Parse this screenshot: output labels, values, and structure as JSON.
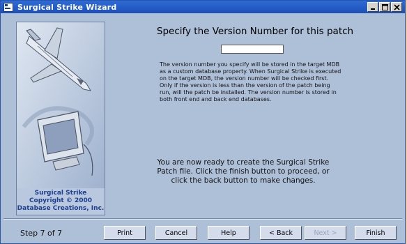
{
  "window": {
    "title": "Surgical Strike Wizard",
    "controls": [
      "minimize",
      "maximize",
      "close"
    ]
  },
  "left_panel": {
    "credit_lines": [
      "Surgical Strike",
      "Copyright © 2000",
      "Database Creations, Inc."
    ]
  },
  "main": {
    "heading": "Specify the Version Number for this patch",
    "version_input": {
      "value": "",
      "placeholder": ""
    },
    "description": "The version number you specify will be stored in the target MDB as a custom database property. When Surgical Strike is executed on the target MDB, the version number will be checked first. Only if the version is less than the version of the patch being run, will the patch be installed. The version number is stored in both front end and back end databases.",
    "ready_text": "You are now ready to create the Surgical Strike Patch file. Click the finish button to proceed, or click the back button to make changes."
  },
  "footer": {
    "step_label": "Step 7 of 7",
    "buttons": {
      "print": "Print",
      "cancel": "Cancel",
      "help": "Help",
      "back": "< Back",
      "next": "Next >",
      "finish": "Finish"
    }
  },
  "colors": {
    "title_bar": "#1c4fb6",
    "window_bg": "#aebfd8",
    "credit_text": "#1c3f8e"
  },
  "icons": [
    "access-app-icon",
    "fighter-jet-icon",
    "computer-monitor-icon"
  ]
}
